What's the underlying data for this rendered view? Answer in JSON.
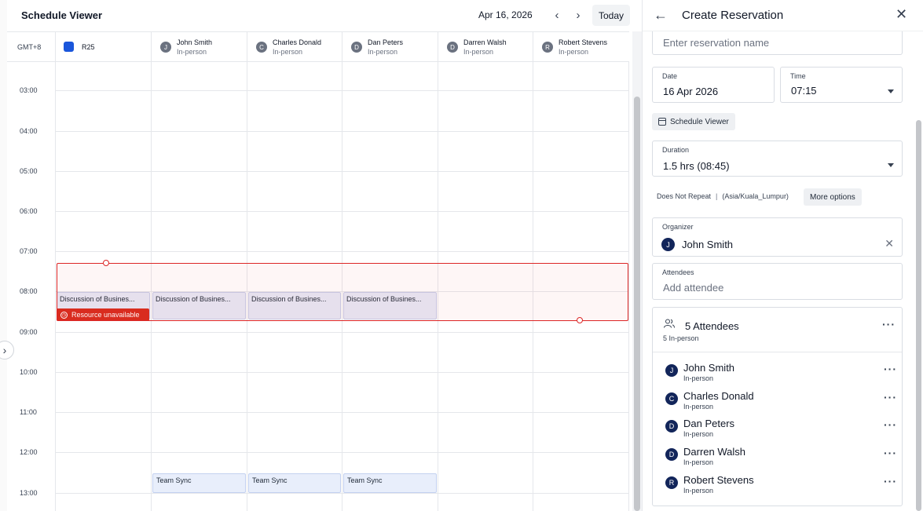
{
  "viewer": {
    "title": "Schedule Viewer",
    "date": "Apr 16, 2026",
    "today_label": "Today",
    "timezone": "GMT+8",
    "resource": {
      "name": "R25",
      "color": "#1a56db"
    },
    "people": [
      {
        "initial": "J",
        "name": "John Smith",
        "mode": "In-person"
      },
      {
        "initial": "C",
        "name": "Charles Donald",
        "mode": "In-person"
      },
      {
        "initial": "D",
        "name": "Dan Peters",
        "mode": "In-person"
      },
      {
        "initial": "D",
        "name": "Darren Walsh",
        "mode": "In-person"
      },
      {
        "initial": "R",
        "name": "Robert Stevens",
        "mode": "In-person"
      }
    ],
    "times": [
      "03:00",
      "04:00",
      "05:00",
      "06:00",
      "07:00",
      "08:00",
      "09:00",
      "10:00",
      "11:00",
      "12:00",
      "13:00"
    ],
    "events": {
      "discussion": [
        "Discussion of Busines...",
        "Discussion of Busines...",
        "Discussion of Busines...",
        "Discussion of Busines..."
      ],
      "unavailable_label": "Resource unavailable",
      "team_sync": [
        "Team Sync",
        "Team Sync",
        "Team Sync"
      ]
    }
  },
  "panel": {
    "title": "Create Reservation",
    "name_placeholder": "Enter reservation name",
    "date": {
      "label": "Date",
      "value": "16 Apr 2026"
    },
    "time": {
      "label": "Time",
      "value": "07:15"
    },
    "viewer_chip": "Schedule Viewer",
    "duration": {
      "label": "Duration",
      "value": "1.5 hrs (08:45)"
    },
    "repeat": "Does Not Repeat",
    "timezone": "(Asia/Kuala_Lumpur)",
    "more_options": "More options",
    "organizer": {
      "label": "Organizer",
      "initial": "J",
      "name": "John Smith"
    },
    "attendees_field": {
      "label": "Attendees",
      "placeholder": "Add attendee"
    },
    "attendees_card": {
      "count_label": "5 Attendees",
      "summary": "5 In-person",
      "list": [
        {
          "initial": "J",
          "name": "John Smith",
          "mode": "In-person"
        },
        {
          "initial": "C",
          "name": "Charles Donald",
          "mode": "In-person"
        },
        {
          "initial": "D",
          "name": "Dan Peters",
          "mode": "In-person"
        },
        {
          "initial": "D",
          "name": "Darren Walsh",
          "mode": "In-person"
        },
        {
          "initial": "R",
          "name": "Robert Stevens",
          "mode": "In-person"
        }
      ]
    }
  },
  "colors": {
    "accent": "#1a56db",
    "selection_border": "#dc2626",
    "avatar": "#12255a",
    "event_bg": "#e7e9f6"
  }
}
